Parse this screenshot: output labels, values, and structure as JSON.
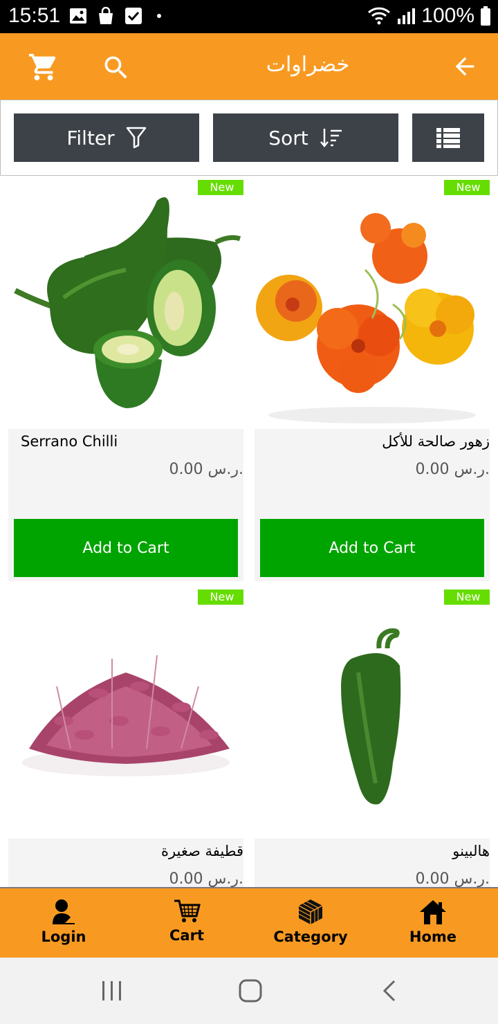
{
  "status_bar": {
    "time": "15:51",
    "battery": "100%",
    "icons_left": [
      "image-icon",
      "shopping-bag-icon",
      "checkbox-icon",
      "dot-icon"
    ],
    "icons_right": [
      "wifi-icon",
      "signal-icon",
      "battery-icon"
    ]
  },
  "app_bar": {
    "title": "خضراوات",
    "color": "#f89a22",
    "icons": [
      "cart-icon",
      "search-icon",
      "back-arrow-icon"
    ]
  },
  "toolbar": {
    "filter_label": "Filter",
    "sort_label": "Sort",
    "button_color": "#3c4248"
  },
  "products": [
    {
      "name": "Serrano Chilli",
      "price": "0.00 ر.س.",
      "badge": "New",
      "button": "Add to Cart"
    },
    {
      "name": "زهور صالحة للأكل",
      "price": "0.00 ر.س.",
      "badge": "New",
      "button": "Add to Cart"
    },
    {
      "name": "قطيفة صغيرة",
      "price": "0.00 ر.س.",
      "badge": "New"
    },
    {
      "name": "هالبينو",
      "price": "0.00 ر.س.",
      "badge": "New"
    }
  ],
  "bottom_nav": {
    "items": [
      {
        "label": "Login",
        "icon": "user-icon"
      },
      {
        "label": "Cart",
        "icon": "cart-icon"
      },
      {
        "label": "Category",
        "icon": "cube-icon"
      },
      {
        "label": "Home",
        "icon": "home-icon"
      }
    ]
  },
  "colors": {
    "accent": "#f89a22",
    "add_to_cart": "#00a400",
    "badge": "#66dd00"
  }
}
